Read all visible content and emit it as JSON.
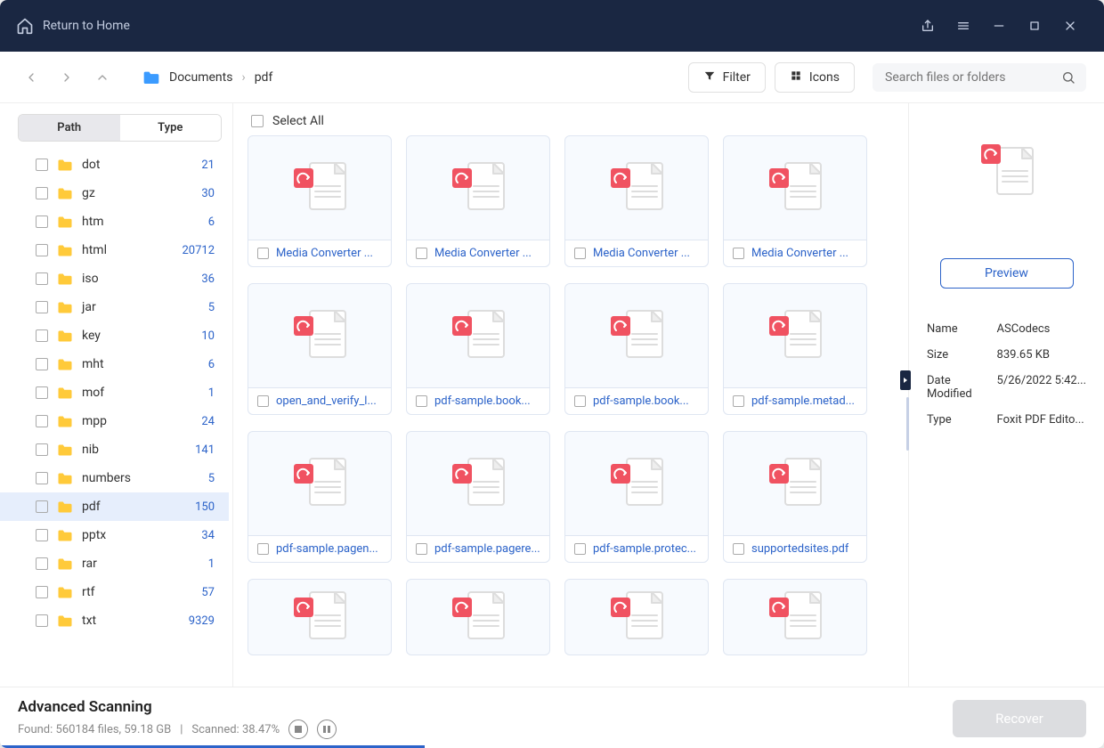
{
  "titlebar": {
    "return_home": "Return to Home"
  },
  "toolbar": {
    "breadcrumb": [
      "Documents",
      "pdf"
    ],
    "filter_label": "Filter",
    "view_label": "Icons",
    "search_placeholder": "Search files or folders"
  },
  "sidebar": {
    "tabs": {
      "path": "Path",
      "type": "Type"
    },
    "folders": [
      {
        "name": "dot",
        "count": "21"
      },
      {
        "name": "gz",
        "count": "30"
      },
      {
        "name": "htm",
        "count": "6"
      },
      {
        "name": "html",
        "count": "20712"
      },
      {
        "name": "iso",
        "count": "36"
      },
      {
        "name": "jar",
        "count": "5"
      },
      {
        "name": "key",
        "count": "10"
      },
      {
        "name": "mht",
        "count": "6"
      },
      {
        "name": "mof",
        "count": "1"
      },
      {
        "name": "mpp",
        "count": "24"
      },
      {
        "name": "nib",
        "count": "141"
      },
      {
        "name": "numbers",
        "count": "5"
      },
      {
        "name": "pdf",
        "count": "150",
        "selected": true
      },
      {
        "name": "pptx",
        "count": "34"
      },
      {
        "name": "rar",
        "count": "1"
      },
      {
        "name": "rtf",
        "count": "57"
      },
      {
        "name": "txt",
        "count": "9329"
      }
    ]
  },
  "main": {
    "select_all": "Select All",
    "files_row1": [
      "Media Converter ...",
      "Media Converter ...",
      "Media Converter ...",
      "Media Converter ..."
    ],
    "files_row2": [
      "open_and_verify_l...",
      "pdf-sample.book...",
      "pdf-sample.book...",
      "pdf-sample.metad..."
    ],
    "files_row3": [
      "pdf-sample.pagen...",
      "pdf-sample.pagere...",
      "pdf-sample.protec...",
      "supportedsites.pdf"
    ]
  },
  "preview": {
    "button": "Preview",
    "labels": {
      "name": "Name",
      "size": "Size",
      "modified": "Date Modified",
      "type": "Type"
    },
    "values": {
      "name": "ASCodecs",
      "size": "839.65 KB",
      "modified": "5/26/2022 5:42...",
      "type": "Foxit PDF Edito..."
    }
  },
  "status": {
    "title": "Advanced Scanning",
    "found_prefix": "Found: ",
    "found_value": "560184 files, 59.18 GB",
    "sep": "|",
    "scanned_prefix": "Scanned: ",
    "scanned_value": "38.47%",
    "recover": "Recover"
  }
}
